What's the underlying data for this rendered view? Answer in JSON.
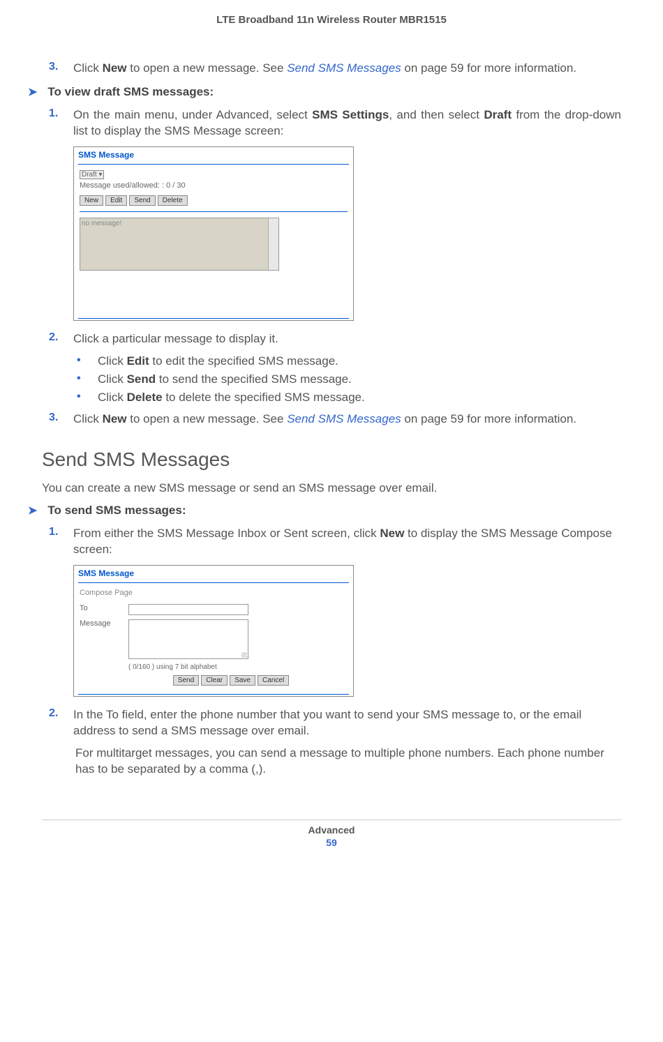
{
  "header": {
    "title": "LTE Broadband 11n Wireless Router MBR1515"
  },
  "top_step3": {
    "num": "3.",
    "pre": "Click ",
    "b1": "New",
    "mid": " to open a new message. See ",
    "link": "Send SMS Messages",
    "post": " on page 59 for more information."
  },
  "view_drafts_heading": "To view draft SMS messages:",
  "draft_step1": {
    "num": "1.",
    "pre": "On the main menu, under Advanced, select ",
    "b1": "SMS Settings",
    "mid": ", and then select ",
    "b2": "Draft",
    "post": " from the drop-down list to display the SMS Message screen:"
  },
  "sms_screen1": {
    "title": "SMS Message",
    "select": "Draft ▾",
    "counter": "Message used/allowed: : 0 / 30",
    "btn_new": "New",
    "btn_edit": "Edit",
    "btn_send": "Send",
    "btn_delete": "Delete",
    "textarea_placeholder": "no message!"
  },
  "draft_step2": {
    "num": "2.",
    "text": "Click a particular message to display it."
  },
  "bullets": {
    "b1_pre": "Click ",
    "b1_bold": "Edit",
    "b1_post": " to edit the specified SMS message.",
    "b2_pre": "Click ",
    "b2_bold": "Send",
    "b2_post": " to send the specified SMS message.",
    "b3_pre": "Click ",
    "b3_bold": "Delete",
    "b3_post": " to delete the specified SMS message."
  },
  "draft_step3": {
    "num": "3.",
    "pre": "Click ",
    "b1": "New",
    "mid": " to open a new message. See ",
    "link": "Send SMS Messages",
    "post": " on page 59 for more information."
  },
  "section_heading": "Send SMS Messages",
  "section_intro": "You can create a new SMS message or send an SMS message over email.",
  "send_heading": "To send SMS messages:",
  "send_step1": {
    "num": "1.",
    "pre": "From either the SMS Message Inbox or Sent screen, click ",
    "b1": "New",
    "post": " to display the SMS Message Compose screen:"
  },
  "sms_screen2": {
    "title": "SMS Message",
    "subtitle": "Compose Page",
    "label_to": "To",
    "label_msg": "Message",
    "counter": "( 0/160 ) using 7 bit alphabet",
    "btn_send": "Send",
    "btn_clear": "Clear",
    "btn_save": "Save",
    "btn_cancel": "Cancel"
  },
  "send_step2": {
    "num": "2.",
    "text": "In the To field, enter the phone number that you want to send your SMS message to, or the email address to send a SMS message over email."
  },
  "send_step2_sub": "For multitarget messages, you can send a message to multiple phone numbers. Each phone number has to be separated by a comma (,).",
  "footer": {
    "section": "Advanced",
    "page": "59"
  }
}
